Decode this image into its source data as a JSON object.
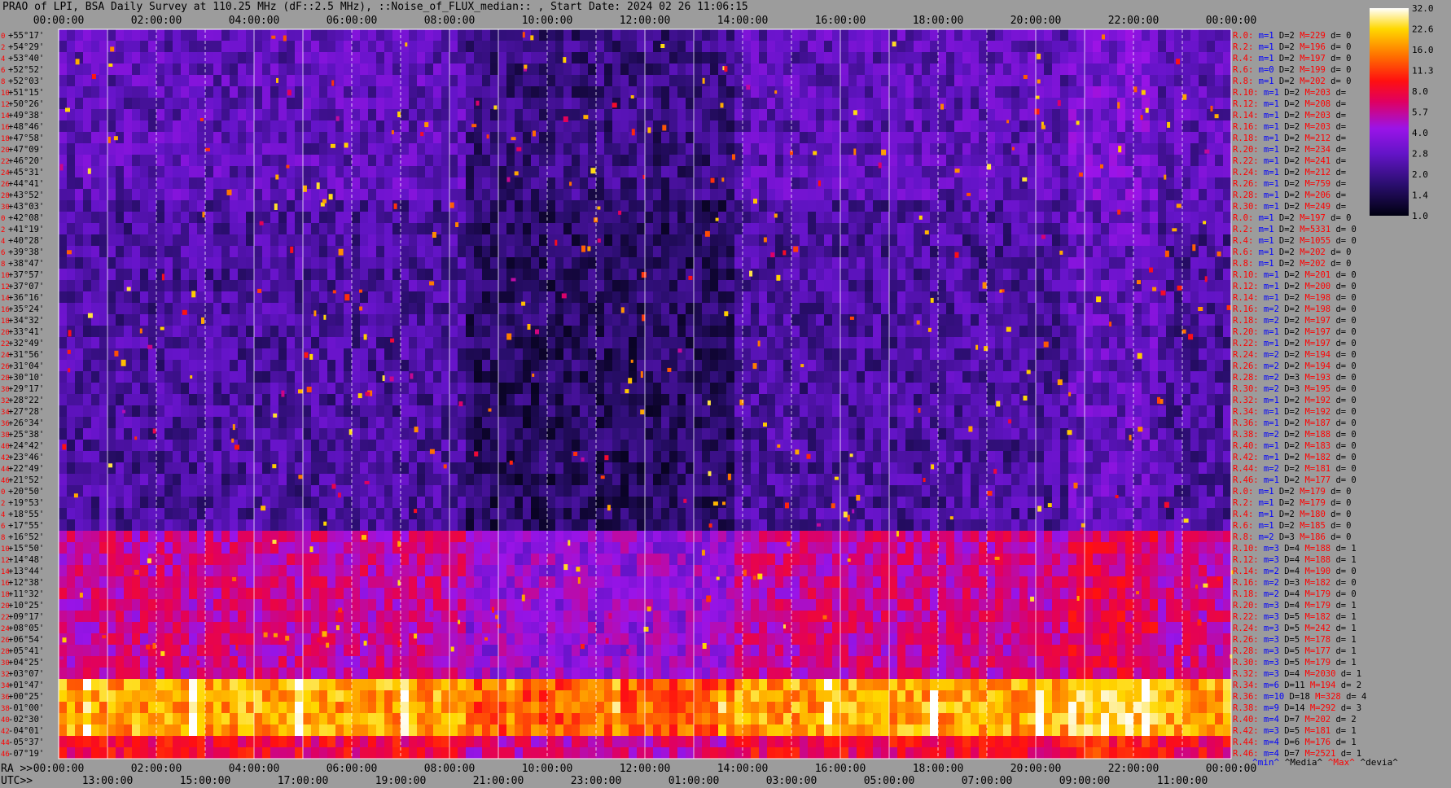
{
  "title": "PRAO of LPI, BSA Daily Survey at 110.25 MHz (dF::2.5 MHz), ::Noise_of_FLUX_median:: , Start Date: 2024 02 26 11:06:15",
  "chart_data": {
    "type": "heatmap",
    "title": "PRAO of LPI, BSA Daily Survey at 110.25 MHz (dF::2.5 MHz), ::Noise_of_FLUX_median:: , Start Date: 2024 02 26 11:06:15",
    "x_top_ticks": [
      "00:00:00",
      "02:00:00",
      "04:00:00",
      "06:00:00",
      "08:00:00",
      "10:00:00",
      "12:00:00",
      "14:00:00",
      "16:00:00",
      "18:00:00",
      "20:00:00",
      "22:00:00",
      "00:00:00"
    ],
    "x_bottom_ra_label": "RA >>",
    "x_bottom_ra_ticks": [
      "00:00:00",
      "02:00:00",
      "04:00:00",
      "06:00:00",
      "08:00:00",
      "10:00:00",
      "12:00:00",
      "14:00:00",
      "16:00:00",
      "18:00:00",
      "20:00:00",
      "22:00:00",
      "00:00:00"
    ],
    "x_bottom_utc_label": "UTC>>",
    "x_bottom_utc_ticks": [
      "13:00:00",
      "15:00:00",
      "17:00:00",
      "19:00:00",
      "21:00:00",
      "23:00:00",
      "01:00:00",
      "03:00:00",
      "05:00:00",
      "07:00:00",
      "09:00:00",
      "11:00:00"
    ],
    "y_declinations": [
      "+55°17'",
      "+54°29'",
      "+53°40'",
      "+52°52'",
      "+52°03'",
      "+51°15'",
      "+50°26'",
      "+49°38'",
      "+48°46'",
      "+47°58'",
      "+47°09'",
      "+46°20'",
      "+45°31'",
      "+44°41'",
      "+43°52'",
      "+43°03'",
      "+42°08'",
      "+41°19'",
      "+40°28'",
      "+39°38'",
      "+38°47'",
      "+37°57'",
      "+37°07'",
      "+36°16'",
      "+35°24'",
      "+34°32'",
      "+33°41'",
      "+32°49'",
      "+31°56'",
      "+31°04'",
      "+30°10'",
      "+29°17'",
      "+28°22'",
      "+27°28'",
      "+26°34'",
      "+25°38'",
      "+24°42'",
      "+23°46'",
      "+22°49'",
      "+21°52'",
      "+20°50'",
      "+19°53'",
      "+18°55'",
      "+17°55'",
      "+16°52'",
      "+15°50'",
      "+14°48'",
      "+13°44'",
      "+12°38'",
      "+11°32'",
      "+10°25'",
      "+09°17'",
      "+08°05'",
      "+06°54'",
      "+05°41'",
      "+04°25'",
      "+03°07'",
      "+01°47'",
      "+00°25'",
      "-01°00'",
      "-02°30'",
      "-04°01'",
      "-05°37'",
      "-07°19'"
    ],
    "beam_numbers": [
      "0",
      "2",
      "4",
      "6",
      "8",
      "10",
      "12",
      "14",
      "16",
      "18",
      "20",
      "22",
      "24",
      "26",
      "28",
      "30",
      "0",
      "2",
      "4",
      "6",
      "8",
      "10",
      "12",
      "14",
      "16",
      "18",
      "20",
      "22",
      "24",
      "26",
      "28",
      "30",
      "32",
      "34",
      "36",
      "38",
      "40",
      "42",
      "44",
      "46",
      "0",
      "2",
      "4",
      "6",
      "8",
      "10",
      "12",
      "14",
      "16",
      "18",
      "20",
      "22",
      "24",
      "26",
      "28",
      "30",
      "32",
      "34",
      "36",
      "38",
      "40",
      "42",
      "44",
      "46"
    ],
    "row_stats": [
      {
        "beam": "R.0:",
        "m": "1",
        "D": "2",
        "M": "229",
        "d": "0"
      },
      {
        "beam": "R.2:",
        "m": "1",
        "D": "2",
        "M": "196",
        "d": "0"
      },
      {
        "beam": "R.4:",
        "m": "1",
        "D": "2",
        "M": "197",
        "d": "0"
      },
      {
        "beam": "R.6:",
        "m": "0",
        "D": "2",
        "M": "199",
        "d": "0"
      },
      {
        "beam": "R.8:",
        "m": "1",
        "D": "2",
        "M": "202",
        "d": "0"
      },
      {
        "beam": "R.10:",
        "m": "1",
        "D": "2",
        "M": "203",
        "d": ""
      },
      {
        "beam": "R.12:",
        "m": "1",
        "D": "2",
        "M": "208",
        "d": ""
      },
      {
        "beam": "R.14:",
        "m": "1",
        "D": "2",
        "M": "203",
        "d": ""
      },
      {
        "beam": "R.16:",
        "m": "1",
        "D": "2",
        "M": "203",
        "d": ""
      },
      {
        "beam": "R.18:",
        "m": "1",
        "D": "2",
        "M": "212",
        "d": ""
      },
      {
        "beam": "R.20:",
        "m": "1",
        "D": "2",
        "M": "234",
        "d": ""
      },
      {
        "beam": "R.22:",
        "m": "1",
        "D": "2",
        "M": "241",
        "d": ""
      },
      {
        "beam": "R.24:",
        "m": "1",
        "D": "2",
        "M": "212",
        "d": ""
      },
      {
        "beam": "R.26:",
        "m": "1",
        "D": "2",
        "M": "759",
        "d": ""
      },
      {
        "beam": "R.28:",
        "m": "1",
        "D": "2",
        "M": "206",
        "d": ""
      },
      {
        "beam": "R.30:",
        "m": "1",
        "D": "2",
        "M": "249",
        "d": ""
      },
      {
        "beam": "R.0:",
        "m": "1",
        "D": "2",
        "M": "197",
        "d": "0"
      },
      {
        "beam": "R.2:",
        "m": "1",
        "D": "2",
        "M": "5331",
        "d": "0"
      },
      {
        "beam": "R.4:",
        "m": "1",
        "D": "2",
        "M": "1055",
        "d": "0"
      },
      {
        "beam": "R.6:",
        "m": "1",
        "D": "2",
        "M": "202",
        "d": "0"
      },
      {
        "beam": "R.8:",
        "m": "1",
        "D": "2",
        "M": "202",
        "d": "0"
      },
      {
        "beam": "R.10:",
        "m": "1",
        "D": "2",
        "M": "201",
        "d": "0"
      },
      {
        "beam": "R.12:",
        "m": "1",
        "D": "2",
        "M": "200",
        "d": "0"
      },
      {
        "beam": "R.14:",
        "m": "1",
        "D": "2",
        "M": "198",
        "d": "0"
      },
      {
        "beam": "R.16:",
        "m": "2",
        "D": "2",
        "M": "198",
        "d": "0"
      },
      {
        "beam": "R.18:",
        "m": "2",
        "D": "2",
        "M": "197",
        "d": "0"
      },
      {
        "beam": "R.20:",
        "m": "1",
        "D": "2",
        "M": "197",
        "d": "0"
      },
      {
        "beam": "R.22:",
        "m": "1",
        "D": "2",
        "M": "197",
        "d": "0"
      },
      {
        "beam": "R.24:",
        "m": "2",
        "D": "2",
        "M": "194",
        "d": "0"
      },
      {
        "beam": "R.26:",
        "m": "2",
        "D": "2",
        "M": "194",
        "d": "0"
      },
      {
        "beam": "R.28:",
        "m": "2",
        "D": "3",
        "M": "193",
        "d": "0"
      },
      {
        "beam": "R.30:",
        "m": "2",
        "D": "3",
        "M": "195",
        "d": "0"
      },
      {
        "beam": "R.32:",
        "m": "1",
        "D": "2",
        "M": "192",
        "d": "0"
      },
      {
        "beam": "R.34:",
        "m": "1",
        "D": "2",
        "M": "192",
        "d": "0"
      },
      {
        "beam": "R.36:",
        "m": "1",
        "D": "2",
        "M": "187",
        "d": "0"
      },
      {
        "beam": "R.38:",
        "m": "2",
        "D": "2",
        "M": "188",
        "d": "0"
      },
      {
        "beam": "R.40:",
        "m": "1",
        "D": "2",
        "M": "183",
        "d": "0"
      },
      {
        "beam": "R.42:",
        "m": "1",
        "D": "2",
        "M": "182",
        "d": "0"
      },
      {
        "beam": "R.44:",
        "m": "2",
        "D": "2",
        "M": "181",
        "d": "0"
      },
      {
        "beam": "R.46:",
        "m": "1",
        "D": "2",
        "M": "177",
        "d": "0"
      },
      {
        "beam": "R.0:",
        "m": "1",
        "D": "2",
        "M": "179",
        "d": "0"
      },
      {
        "beam": "R.2:",
        "m": "1",
        "D": "2",
        "M": "179",
        "d": "0"
      },
      {
        "beam": "R.4:",
        "m": "1",
        "D": "2",
        "M": "180",
        "d": "0"
      },
      {
        "beam": "R.6:",
        "m": "1",
        "D": "2",
        "M": "185",
        "d": "0"
      },
      {
        "beam": "R.8:",
        "m": "2",
        "D": "3",
        "M": "186",
        "d": "0"
      },
      {
        "beam": "R.10:",
        "m": "3",
        "D": "4",
        "M": "188",
        "d": "1"
      },
      {
        "beam": "R.12:",
        "m": "3",
        "D": "4",
        "M": "188",
        "d": "1"
      },
      {
        "beam": "R.14:",
        "m": "2",
        "D": "4",
        "M": "190",
        "d": "0"
      },
      {
        "beam": "R.16:",
        "m": "2",
        "D": "3",
        "M": "182",
        "d": "0"
      },
      {
        "beam": "R.18:",
        "m": "2",
        "D": "4",
        "M": "179",
        "d": "0"
      },
      {
        "beam": "R.20:",
        "m": "3",
        "D": "4",
        "M": "179",
        "d": "1"
      },
      {
        "beam": "R.22:",
        "m": "3",
        "D": "5",
        "M": "182",
        "d": "1"
      },
      {
        "beam": "R.24:",
        "m": "3",
        "D": "5",
        "M": "242",
        "d": "1"
      },
      {
        "beam": "R.26:",
        "m": "3",
        "D": "5",
        "M": "178",
        "d": "1"
      },
      {
        "beam": "R.28:",
        "m": "3",
        "D": "5",
        "M": "177",
        "d": "1"
      },
      {
        "beam": "R.30:",
        "m": "3",
        "D": "5",
        "M": "179",
        "d": "1"
      },
      {
        "beam": "R.32:",
        "m": "3",
        "D": "4",
        "M": "2030",
        "d": "1"
      },
      {
        "beam": "R.34:",
        "m": "6",
        "D": "11",
        "M": "194",
        "d": "2"
      },
      {
        "beam": "R.36:",
        "m": "10",
        "D": "18",
        "M": "328",
        "d": "4"
      },
      {
        "beam": "R.38:",
        "m": "9",
        "D": "14",
        "M": "292",
        "d": "3"
      },
      {
        "beam": "R.40:",
        "m": "4",
        "D": "7",
        "M": "202",
        "d": "2"
      },
      {
        "beam": "R.42:",
        "m": "3",
        "D": "5",
        "M": "181",
        "d": "1"
      },
      {
        "beam": "R.44:",
        "m": "4",
        "D": "6",
        "M": "176",
        "d": "1"
      },
      {
        "beam": "R.46:",
        "m": "4",
        "D": "7",
        "M": "2521",
        "d": "1"
      }
    ],
    "stats_legend": {
      "min": "^min^",
      "median": "^Media^",
      "max": "^Max^",
      "dev": "^devia^"
    },
    "colorbar_ticks": [
      "32.0",
      "22.6",
      "16.0",
      "11.3",
      "8.0",
      "5.7",
      "4.0",
      "2.8",
      "2.0",
      "1.4",
      "1.0"
    ],
    "colorbar_scale": "log",
    "colors": {
      "background": "#9c9c9c",
      "label_red": "#ff0000",
      "label_blue": "#0000ff",
      "label_black": "#000000"
    }
  }
}
